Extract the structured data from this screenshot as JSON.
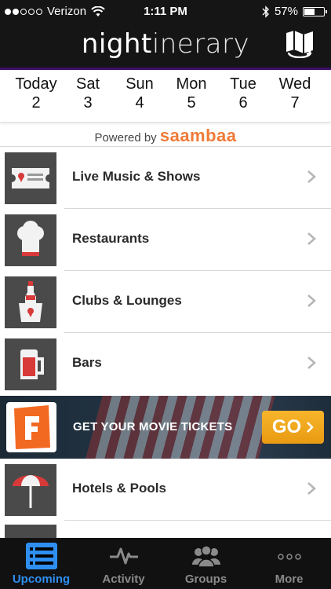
{
  "status_bar": {
    "carrier": "Verizon",
    "time": "1:11 PM",
    "battery": "57%",
    "battery_level": 0.57,
    "signal_bars_on": 2,
    "signal_bars_total": 5
  },
  "header": {
    "logo_bold": "night",
    "logo_light": "inerary",
    "map_icon": "folded-map-icon",
    "accent_color": "#3c0d68"
  },
  "dates": [
    {
      "day": "Today",
      "num": "2"
    },
    {
      "day": "Sat",
      "num": "3"
    },
    {
      "day": "Sun",
      "num": "4"
    },
    {
      "day": "Mon",
      "num": "5"
    },
    {
      "day": "Tue",
      "num": "6"
    },
    {
      "day": "Wed",
      "num": "7"
    }
  ],
  "powered": {
    "prefix": "Powered by",
    "brand": "saambaa",
    "brand_color": "#f07a36"
  },
  "categories": [
    {
      "label": "Live Music & Shows",
      "icon": "ticket-icon"
    },
    {
      "label": "Restaurants",
      "icon": "chef-hat-icon"
    },
    {
      "label": "Clubs & Lounges",
      "icon": "bottle-bucket-icon"
    },
    {
      "label": "Bars",
      "icon": "beer-mug-icon"
    }
  ],
  "banner": {
    "text": "GET YOUR MOVIE TICKETS",
    "go": "GO",
    "brand_icon": "fandango-icon"
  },
  "categories2": [
    {
      "label": "Hotels & Pools",
      "icon": "umbrella-icon"
    }
  ],
  "tabs": [
    {
      "label": "Upcoming",
      "icon": "list-icon",
      "active": true
    },
    {
      "label": "Activity",
      "icon": "pulse-icon",
      "active": false
    },
    {
      "label": "Groups",
      "icon": "people-icon",
      "active": false
    },
    {
      "label": "More",
      "icon": "ellipsis-icon",
      "active": false
    }
  ],
  "colors": {
    "active_tab": "#2e8ff0",
    "go_button": "#f0a81c"
  }
}
